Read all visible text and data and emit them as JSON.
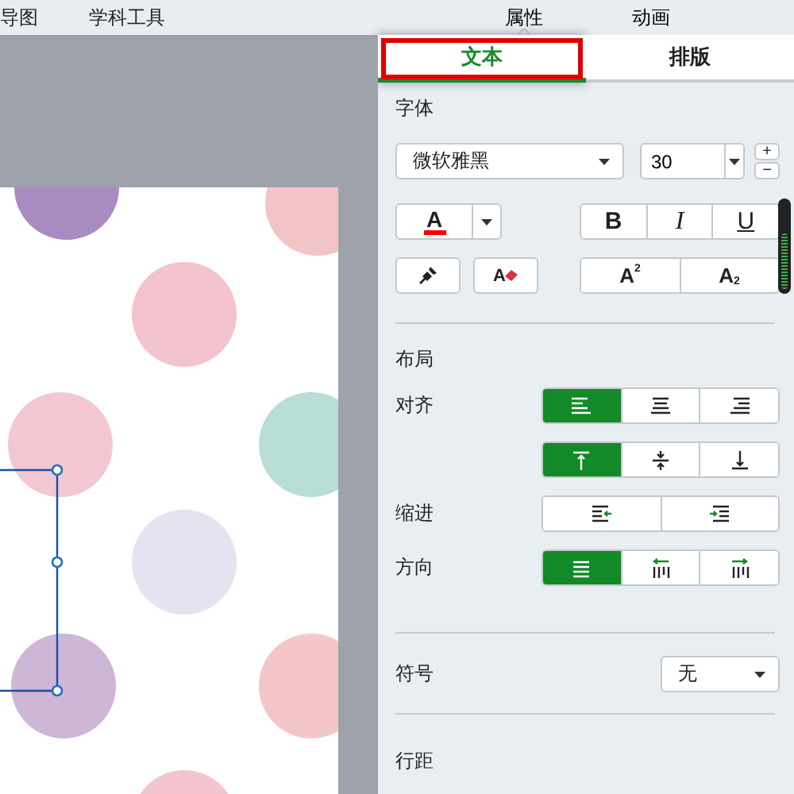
{
  "menu": [
    {
      "label": "导图"
    },
    {
      "label": "学科工具"
    }
  ],
  "panel_tabs": [
    {
      "label": "属性",
      "selected": true
    },
    {
      "label": "动画",
      "selected": false
    }
  ],
  "sub_tabs": [
    {
      "label": "文本",
      "selected": true,
      "highlighted": true
    },
    {
      "label": "排版",
      "selected": false,
      "highlighted": false
    }
  ],
  "font": {
    "section": "字体",
    "family": "微软雅黑",
    "size": "30",
    "increase": "+",
    "decrease": "−"
  },
  "font_color": {
    "label": "A",
    "color": "#ff0000"
  },
  "style_buttons": [
    {
      "kind": "bold",
      "label": "B"
    },
    {
      "kind": "italic",
      "label": "I"
    },
    {
      "kind": "underline",
      "label": "U"
    }
  ],
  "clear_format": {
    "label": "A"
  },
  "script_buttons": [
    {
      "kind": "superscript",
      "label": "A",
      "mark": "2"
    },
    {
      "kind": "subscript",
      "label": "A",
      "mark": "2"
    }
  ],
  "layout": {
    "section": "布局",
    "rows": [
      {
        "label": "对齐",
        "buttons": [
          {
            "kind": "align-left",
            "selected": true
          },
          {
            "kind": "align-center",
            "selected": false
          },
          {
            "kind": "align-right",
            "selected": false
          }
        ]
      },
      {
        "buttons": [
          {
            "kind": "valign-top",
            "selected": true
          },
          {
            "kind": "valign-middle",
            "selected": false
          },
          {
            "kind": "valign-bottom",
            "selected": false
          }
        ]
      },
      {
        "label": "缩进",
        "buttons": [
          {
            "kind": "indent-decrease",
            "selected": false
          },
          {
            "kind": "indent-increase",
            "selected": false
          }
        ]
      },
      {
        "label": "方向",
        "buttons": [
          {
            "kind": "horizontal",
            "selected": true
          },
          {
            "kind": "vertical-rtl",
            "selected": false
          },
          {
            "kind": "vertical-ltr",
            "selected": false
          }
        ]
      }
    ]
  },
  "symbol": {
    "label": "符号",
    "value": "无"
  },
  "line_spacing": {
    "label": "行距"
  }
}
